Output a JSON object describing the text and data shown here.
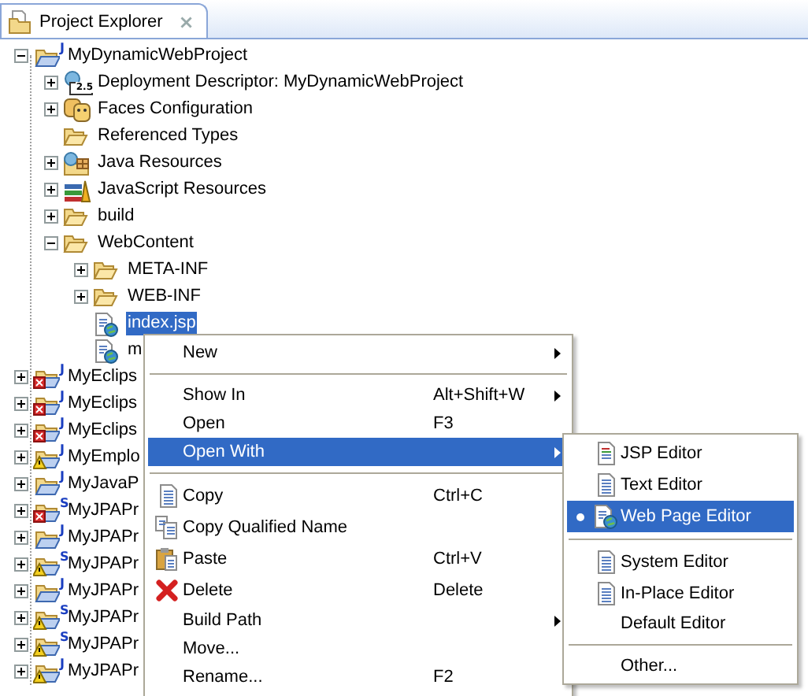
{
  "view": {
    "title": "Project Explorer",
    "close": "×"
  },
  "tree": [
    {
      "label": "MyDynamicWebProject",
      "kind": "project",
      "badge": "J",
      "expanded": true,
      "selected": false,
      "children": [
        {
          "label": "Deployment Descriptor: MyDynamicWebProject",
          "kind": "descriptor",
          "badge": "2.5",
          "expanded": false,
          "selected": false
        },
        {
          "label": "Faces Configuration",
          "kind": "faces",
          "expanded": false,
          "selected": false
        },
        {
          "label": "Referenced Types",
          "kind": "folder",
          "selected": false
        },
        {
          "label": "Java Resources",
          "kind": "java-resources",
          "expanded": false,
          "selected": false
        },
        {
          "label": "JavaScript Resources",
          "kind": "js-resources",
          "expanded": false,
          "selected": false
        },
        {
          "label": "build",
          "kind": "folder",
          "expanded": false,
          "selected": false
        },
        {
          "label": "WebContent",
          "kind": "folder",
          "expanded": true,
          "selected": false,
          "children": [
            {
              "label": "META-INF",
              "kind": "folder",
              "expanded": false,
              "selected": false
            },
            {
              "label": "WEB-INF",
              "kind": "folder",
              "expanded": false,
              "selected": false
            },
            {
              "label": "index.jsp",
              "kind": "web-file",
              "selected": true
            },
            {
              "label": "m",
              "kind": "web-file",
              "selected": false
            }
          ]
        }
      ]
    },
    {
      "label": "MyEclips",
      "kind": "project-error",
      "badge": "J",
      "expanded": false,
      "selected": false
    },
    {
      "label": "MyEclips",
      "kind": "project-error",
      "badge": "J",
      "expanded": false,
      "selected": false
    },
    {
      "label": "MyEclips",
      "kind": "project-error",
      "badge": "J",
      "expanded": false,
      "selected": false
    },
    {
      "label": "MyEmplo",
      "kind": "project-warning",
      "badge": "J",
      "expanded": false,
      "selected": false
    },
    {
      "label": "MyJavaP",
      "kind": "project",
      "badge": "J",
      "expanded": false,
      "selected": false
    },
    {
      "label": "MyJPAPr",
      "kind": "project-error",
      "badge": "S",
      "expanded": false,
      "selected": false
    },
    {
      "label": "MyJPAPr",
      "kind": "project",
      "badge": "J",
      "expanded": false,
      "selected": false
    },
    {
      "label": "MyJPAPr",
      "kind": "project-warning",
      "badge": "S",
      "expanded": false,
      "selected": false
    },
    {
      "label": "MyJPAPr",
      "kind": "project",
      "badge": "J",
      "expanded": false,
      "selected": false
    },
    {
      "label": "MyJPAPr",
      "kind": "project-warning",
      "badge": "S",
      "expanded": false,
      "selected": false
    },
    {
      "label": "MyJPAPr",
      "kind": "project-warning",
      "badge": "S",
      "expanded": false,
      "selected": false
    },
    {
      "label": "MyJPAPr",
      "kind": "project-warning",
      "badge": "J",
      "expanded": false,
      "selected": false
    }
  ],
  "context_menu": [
    {
      "kind": "item",
      "label": "New",
      "submenu": true,
      "selected": false
    },
    {
      "kind": "separator"
    },
    {
      "kind": "item",
      "label": "Show In",
      "shortcut": "Alt+Shift+W",
      "submenu": true,
      "selected": false
    },
    {
      "kind": "item",
      "label": "Open",
      "shortcut": "F3",
      "submenu": false,
      "selected": false
    },
    {
      "kind": "item",
      "label": "Open With",
      "submenu": true,
      "selected": true
    },
    {
      "kind": "separator"
    },
    {
      "kind": "item",
      "label": "Copy",
      "shortcut": "Ctrl+C",
      "submenu": false,
      "selected": false
    },
    {
      "kind": "item",
      "label": "Copy Qualified Name",
      "submenu": false,
      "selected": false
    },
    {
      "kind": "item",
      "label": "Paste",
      "shortcut": "Ctrl+V",
      "submenu": false,
      "selected": false
    },
    {
      "kind": "item",
      "label": "Delete",
      "shortcut": "Delete",
      "submenu": false,
      "selected": false
    },
    {
      "kind": "item",
      "label": "Build Path",
      "submenu": true,
      "selected": false
    },
    {
      "kind": "item",
      "label": "Move...",
      "submenu": false,
      "selected": false
    },
    {
      "kind": "item",
      "label": "Rename...",
      "shortcut": "F2",
      "submenu": false,
      "selected": false
    }
  ],
  "open_with_menu": [
    {
      "kind": "item",
      "label": "JSP Editor",
      "checked": false,
      "selected": false
    },
    {
      "kind": "item",
      "label": "Text Editor",
      "checked": false,
      "selected": false
    },
    {
      "kind": "item",
      "label": "Web Page Editor",
      "checked": true,
      "selected": true
    },
    {
      "kind": "separator"
    },
    {
      "kind": "item",
      "label": "System Editor",
      "checked": false,
      "selected": false
    },
    {
      "kind": "item",
      "label": "In-Place Editor",
      "checked": false,
      "selected": false
    },
    {
      "kind": "item",
      "label": "Default Editor",
      "checked": false,
      "selected": false
    },
    {
      "kind": "separator"
    },
    {
      "kind": "item",
      "label": "Other...",
      "checked": false,
      "selected": false
    }
  ]
}
